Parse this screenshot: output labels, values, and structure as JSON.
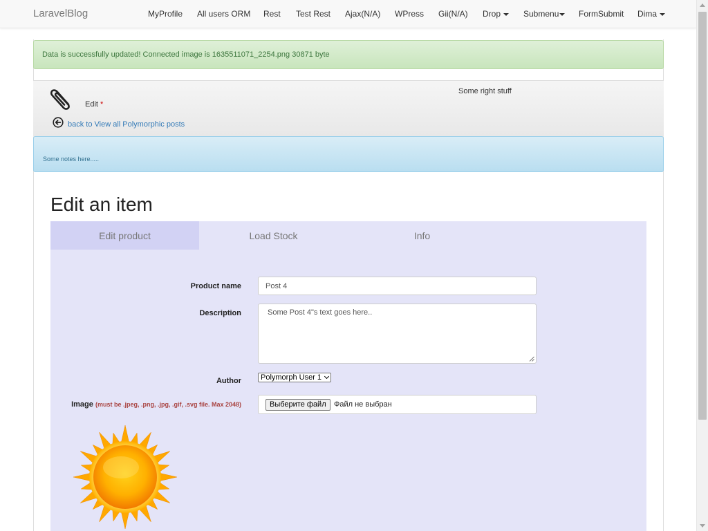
{
  "navbar": {
    "brand": "LaravelBlog",
    "items": [
      {
        "label": "MyProfile",
        "caret": false
      },
      {
        "label": "All users ORM",
        "caret": false
      },
      {
        "label": "Rest",
        "caret": false
      },
      {
        "label": "Test Rest",
        "caret": false
      },
      {
        "label": "Ajax(N/A)",
        "caret": false
      },
      {
        "label": "WPress",
        "caret": false
      },
      {
        "label": "Gii(N/A)",
        "caret": false
      },
      {
        "label": "Drop",
        "caret": true
      },
      {
        "label": "Submenu",
        "caret": true
      },
      {
        "label": "FormSubmit",
        "caret": false
      },
      {
        "label": "Dima",
        "caret": true
      }
    ]
  },
  "alerts": {
    "success": "Data is successfully updated! Connected image is 1635511071_2254.png 30871 byte",
    "info": "Some notes here....."
  },
  "header": {
    "edit_label": "Edit",
    "edit_required": "*",
    "right_text": "Some right stuff",
    "back_link": "back to View all Polymorphic posts",
    "icons": {
      "main": "paperclip-icon",
      "back": "circle-arrow-left-icon"
    }
  },
  "page": {
    "title": "Edit an item"
  },
  "tabs": [
    {
      "label": "Edit product",
      "active": true
    },
    {
      "label": "Load Stock",
      "active": false
    },
    {
      "label": "Info",
      "active": false
    }
  ],
  "form": {
    "product_name": {
      "label": "Product name",
      "value": "Post 4"
    },
    "description": {
      "label": "Description",
      "value": "Some Post 4\"s text goes here.."
    },
    "author": {
      "label": "Author",
      "selected": "Polymorph User 1"
    },
    "image": {
      "label": "Image",
      "hint": "(must be .jpeg, .png, .jpg, .gif, .svg file. Max 2048)",
      "button_label": "Выберите файл",
      "status": "Файл не выбран"
    },
    "preview_image": "sun-image"
  },
  "colors": {
    "success_bg": "#dff0d8",
    "info_bg": "#d9edf7",
    "tab_panel_bg": "#e4e4f8",
    "tab_active_bg": "#d2d2f4",
    "link": "#337ab7",
    "hint": "#a94442"
  }
}
